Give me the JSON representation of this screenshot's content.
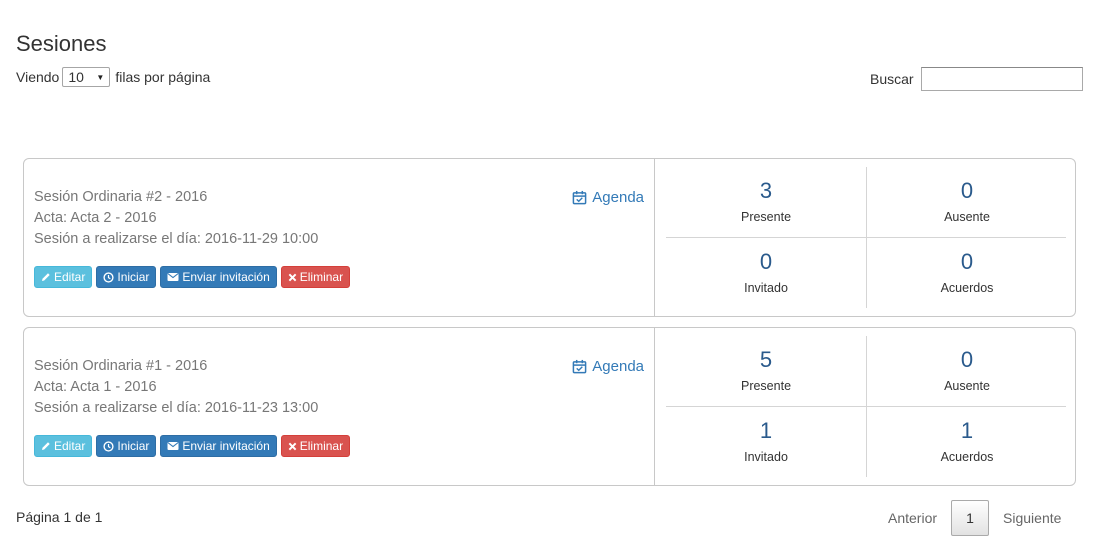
{
  "page": {
    "title": "Sesiones"
  },
  "length_menu": {
    "prefix": "Viendo",
    "selected": "10",
    "suffix": "filas por página"
  },
  "search": {
    "label": "Buscar",
    "value": ""
  },
  "sessions": [
    {
      "title": "Sesión Ordinaria #2 - 2016",
      "acta": "Acta: Acta 2 - 2016",
      "date": "Sesión a realizarse el día: 2016-11-29 10:00",
      "agenda": "Agenda",
      "buttons": {
        "edit": "Editar",
        "start": "Iniciar",
        "invite": "Enviar invitación",
        "delete": "Eliminar"
      },
      "stats": {
        "presente": {
          "value": "3",
          "label": "Presente"
        },
        "ausente": {
          "value": "0",
          "label": "Ausente"
        },
        "invitado": {
          "value": "0",
          "label": "Invitado"
        },
        "acuerdos": {
          "value": "0",
          "label": "Acuerdos"
        }
      }
    },
    {
      "title": "Sesión Ordinaria #1 - 2016",
      "acta": "Acta: Acta 1 - 2016",
      "date": "Sesión a realizarse el día: 2016-11-23 13:00",
      "agenda": "Agenda",
      "buttons": {
        "edit": "Editar",
        "start": "Iniciar",
        "invite": "Enviar invitación",
        "delete": "Eliminar"
      },
      "stats": {
        "presente": {
          "value": "5",
          "label": "Presente"
        },
        "ausente": {
          "value": "0",
          "label": "Ausente"
        },
        "invitado": {
          "value": "1",
          "label": "Invitado"
        },
        "acuerdos": {
          "value": "1",
          "label": "Acuerdos"
        }
      }
    }
  ],
  "pagination": {
    "info": "Página 1 de 1",
    "previous": "Anterior",
    "current": "1",
    "next": "Siguiente"
  },
  "colors": {
    "primary": "#337ab7",
    "info": "#5bc0de",
    "danger": "#d9534f",
    "stat_number": "#2a5a8c"
  }
}
